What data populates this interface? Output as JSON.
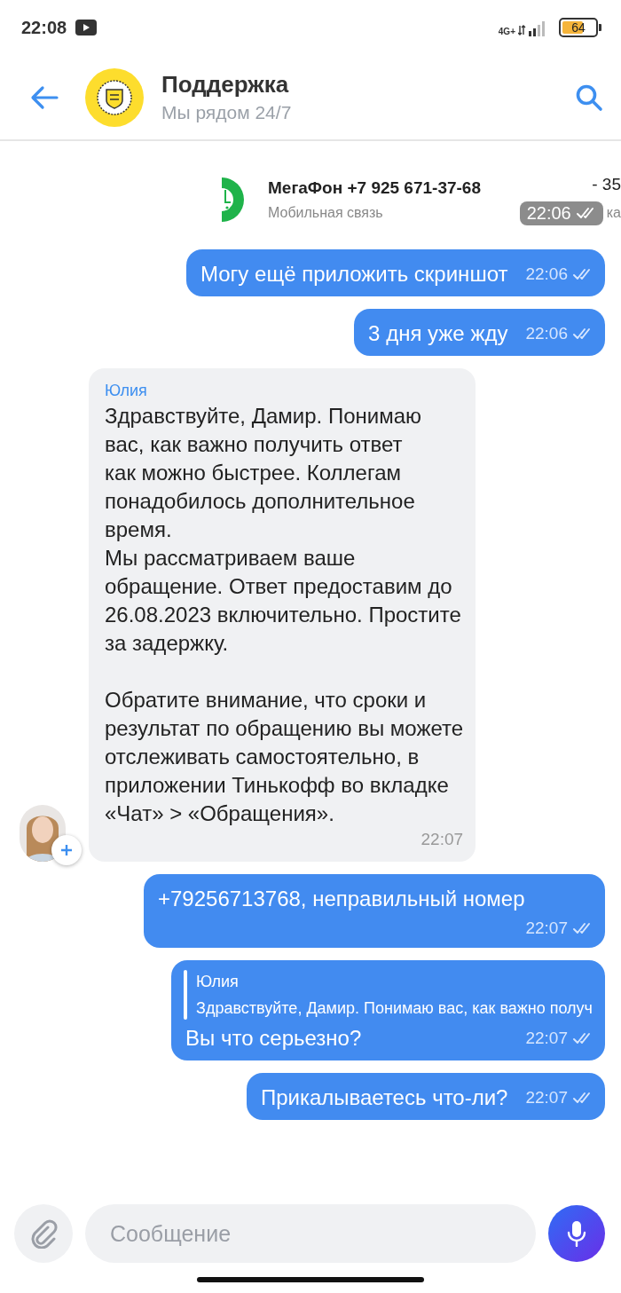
{
  "status_bar": {
    "time": "22:08",
    "network": "4G+",
    "battery": "64"
  },
  "header": {
    "title": "Поддержка",
    "subtitle": "Мы рядом 24/7"
  },
  "messages": [
    {
      "kind": "screenshot",
      "title": "МегаФон +7 925 671-37-68",
      "subtitle": "Мобильная связь",
      "amount": "- 35",
      "account": "ка",
      "time": "22:06"
    },
    {
      "kind": "outgoing",
      "text": "Могу ещё приложить скриншот",
      "time": "22:06"
    },
    {
      "kind": "outgoing",
      "text": "3 дня уже жду",
      "time": "22:06"
    },
    {
      "kind": "incoming",
      "sender": "Юлия",
      "text": "Здравствуйте, Дамир. Понимаю\nвас, как важно получить ответ\nкак можно быстрее. Коллегам\nпонадобилось дополнительное\nвремя.\nМы рассматриваем ваше\nобращение. Ответ предоставим до\n26.08.2023 включительно. Простите\nза задержку.\n\nОбратите внимание, что сроки и\nрезультат по обращению вы можете\nотслеживать самостоятельно, в\nприложении Тинькофф во вкладке\n«Чат» > «Обращения».",
      "time": "22:07"
    },
    {
      "kind": "outgoing",
      "text": "+79256713768, неправильный номер",
      "time": "22:07"
    },
    {
      "kind": "outgoing",
      "reply_to": {
        "sender": "Юлия",
        "text": "Здравствуйте, Дамир. Понимаю вас, как важно получ"
      },
      "text": "Вы что серьезно?",
      "time": "22:07"
    },
    {
      "kind": "outgoing",
      "text": "Прикалываетесь что-ли?",
      "time": "22:07"
    }
  ],
  "composer": {
    "placeholder": "Сообщение"
  }
}
